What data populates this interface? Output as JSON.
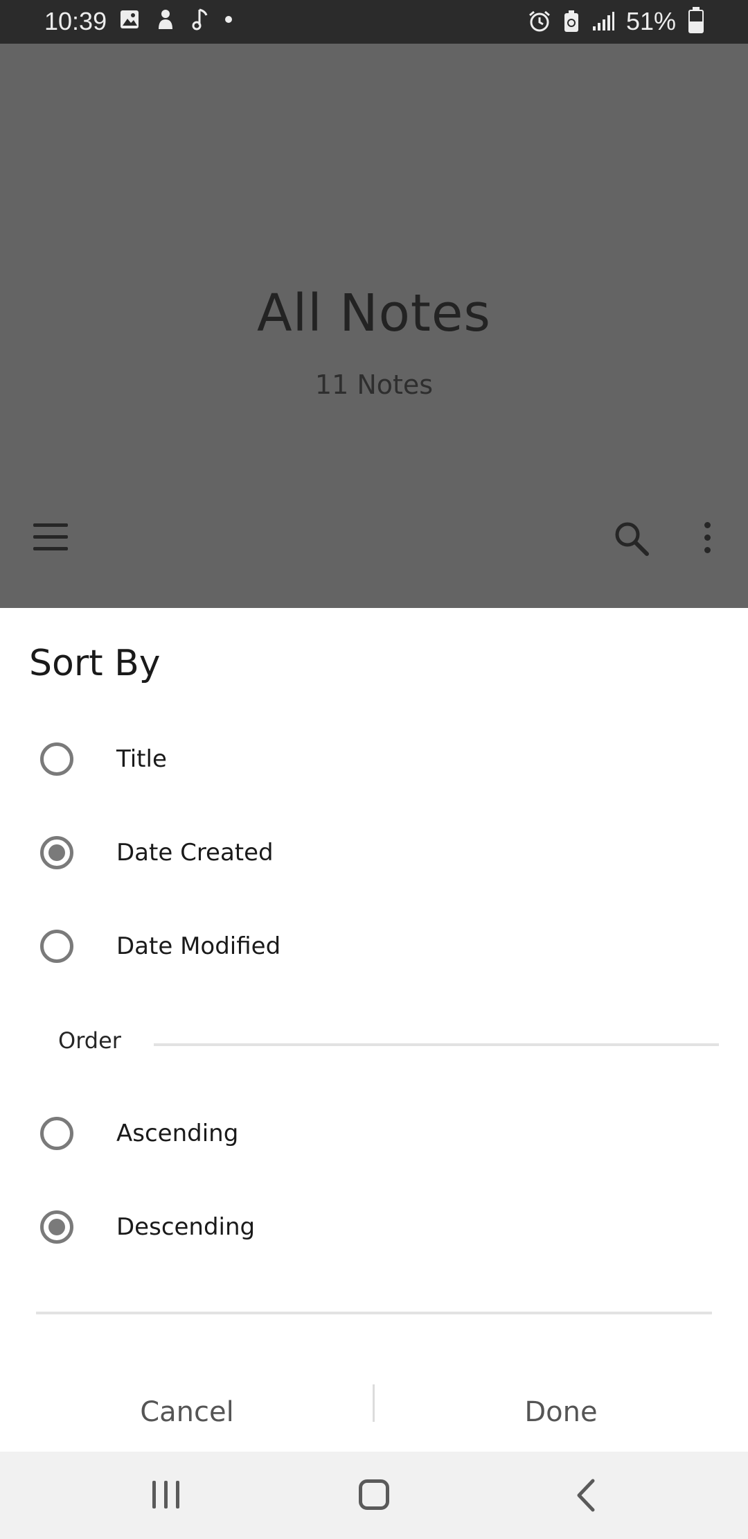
{
  "status_bar": {
    "time": "10:39",
    "left_icons": [
      "image-icon",
      "notification-icon",
      "music-note-icon",
      "dot-icon"
    ],
    "right_icons": [
      "alarm-icon",
      "battery-saver-icon",
      "signal-icon"
    ],
    "battery_percent": "51%",
    "battery_level": 0.51
  },
  "app": {
    "title": "All Notes",
    "subtitle": "11 Notes",
    "toolbar_icons": [
      "menu-icon",
      "search-icon",
      "more-options-icon"
    ]
  },
  "dialog": {
    "title": "Sort By",
    "sort_options": [
      {
        "label": "Title",
        "checked": false
      },
      {
        "label": "Date Created",
        "checked": true
      },
      {
        "label": "Date Modified",
        "checked": false
      }
    ],
    "order_heading": "Order",
    "order_options": [
      {
        "label": "Ascending",
        "checked": false
      },
      {
        "label": "Descending",
        "checked": true
      }
    ],
    "cancel_label": "Cancel",
    "done_label": "Done"
  },
  "nav_bar": {
    "icons": [
      "recents-icon",
      "home-icon",
      "back-icon"
    ]
  }
}
